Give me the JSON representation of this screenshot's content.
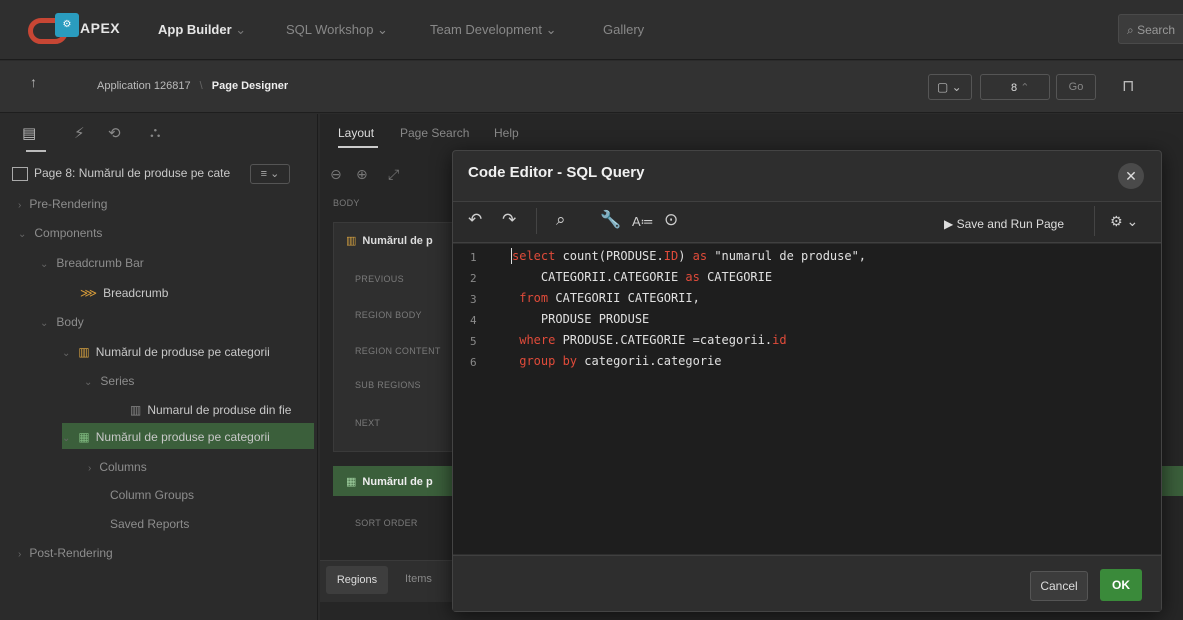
{
  "nav": {
    "brand": "APEX",
    "items": [
      "App Builder",
      "SQL Workshop",
      "Team Development",
      "Gallery"
    ],
    "search_placeholder": "Search"
  },
  "subbar": {
    "app_icon_text": "⚙",
    "breadcrumb_app": "Application 126817",
    "breadcrumb_page": "Page Designer",
    "page_number": "8",
    "go_label": "Go"
  },
  "left": {
    "page_title": "Page 8: Numărul de produse pe cate",
    "tree": {
      "pre_rendering": "Pre-Rendering",
      "components": "Components",
      "breadcrumb_bar": "Breadcrumb Bar",
      "breadcrumb": "Breadcrumb",
      "body": "Body",
      "chart_region": "Numărul de produse pe categorii",
      "series": "Series",
      "series_item": "Numarul de produse din fie",
      "report_region": "Numărul de produse pe categorii",
      "columns": "Columns",
      "column_groups": "Column Groups",
      "saved_reports": "Saved Reports",
      "post_rendering": "Post-Rendering"
    }
  },
  "middle": {
    "tabs": [
      "Layout",
      "Page Search",
      "Help"
    ],
    "body_label": "BODY",
    "region1_title": "Numărul de p",
    "slots": [
      "PREVIOUS",
      "REGION BODY",
      "REGION CONTENT",
      "SUB REGIONS",
      "NEXT"
    ],
    "region2_title": "Numărul de p",
    "sort_order": "SORT ORDER",
    "bottom_tabs": [
      "Regions",
      "Items"
    ]
  },
  "dialog": {
    "title": "Code Editor - SQL Query",
    "save_run": "Save and Run Page",
    "cancel": "Cancel",
    "ok": "OK",
    "line_numbers": [
      "1",
      "2",
      "3",
      "4",
      "5",
      "6"
    ]
  },
  "colors": {
    "accent_red": "#c74634",
    "ok_green": "#3a8a3a",
    "keyword": "#e04b3a"
  }
}
